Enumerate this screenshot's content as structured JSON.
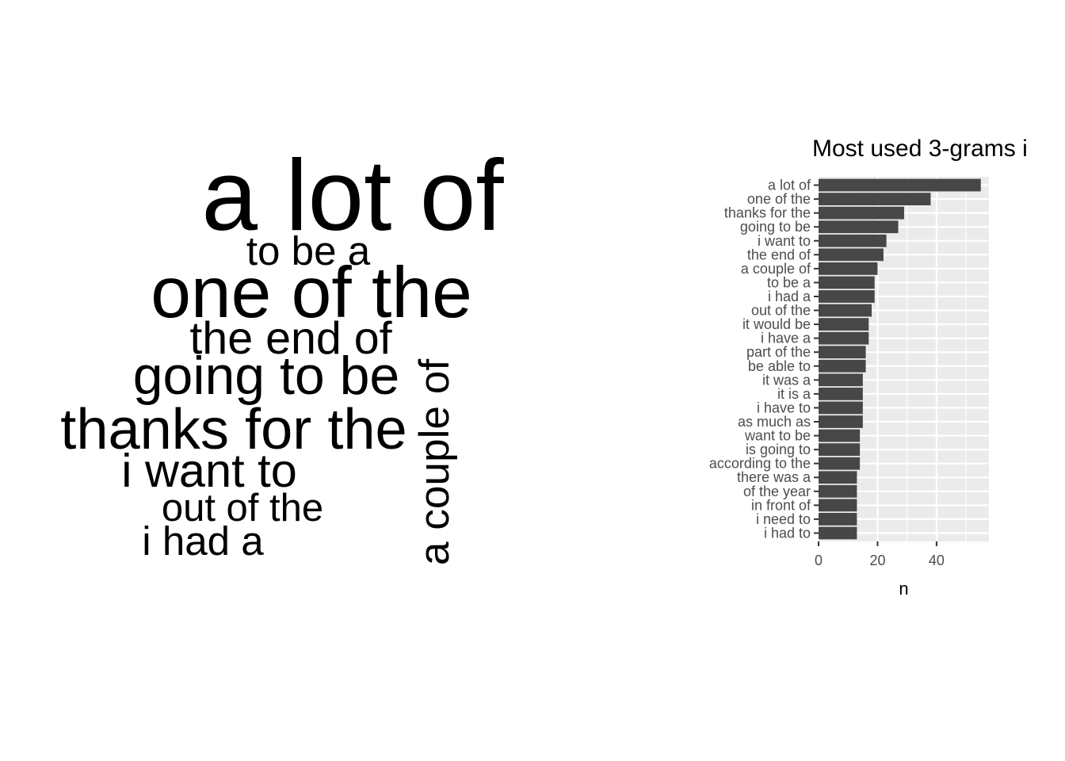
{
  "chart_data": [
    {
      "type": "wordcloud",
      "words": [
        {
          "text": "a lot of",
          "n": 55
        },
        {
          "text": "one of the",
          "n": 38
        },
        {
          "text": "thanks for the",
          "n": 29
        },
        {
          "text": "going to be",
          "n": 27
        },
        {
          "text": "i want to",
          "n": 23
        },
        {
          "text": "the end of",
          "n": 22
        },
        {
          "text": "a couple of",
          "n": 20
        },
        {
          "text": "to be a",
          "n": 19
        },
        {
          "text": "i had a",
          "n": 19
        },
        {
          "text": "out of the",
          "n": 18
        }
      ]
    },
    {
      "type": "bar",
      "orientation": "horizontal",
      "title": "Most used 3-grams i",
      "xlabel": "n",
      "ylabel": "",
      "xlim": [
        0,
        57.75
      ],
      "xticks": [
        0,
        20,
        40
      ],
      "grid": true,
      "legend": "none",
      "bar_color": "#474747",
      "panel_color": "#ebebeb",
      "categories": [
        "a lot of",
        "one of the",
        "thanks for the",
        "going to be",
        "i want to",
        "the end of",
        "a couple of",
        "to be a",
        "i had a",
        "out of the",
        "it would be",
        "i have a",
        "part of the",
        "be able to",
        "it was a",
        "it is a",
        "i have to",
        "as much as",
        "want to be",
        "is going to",
        "according to the",
        "there was a",
        "of the year",
        "in front of",
        "i need to",
        "i had to"
      ],
      "values": [
        55,
        38,
        29,
        27,
        23,
        22,
        20,
        19,
        19,
        18,
        17,
        17,
        16,
        16,
        15,
        15,
        15,
        15,
        14,
        14,
        14,
        13,
        13,
        13,
        13,
        13
      ]
    }
  ]
}
